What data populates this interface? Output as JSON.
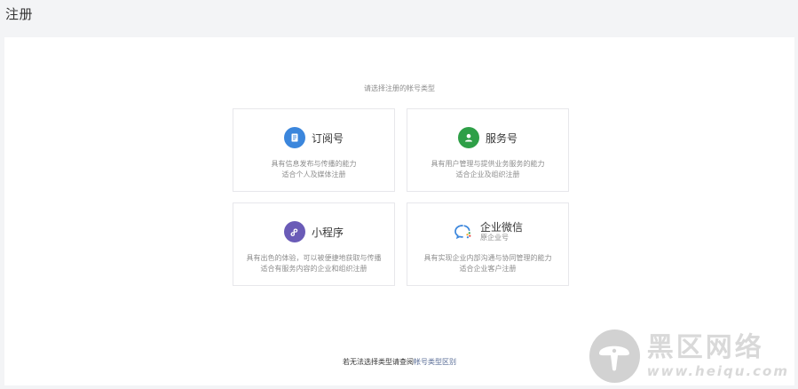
{
  "page": {
    "title": "注册",
    "subtitle": "请选择注册的帐号类型"
  },
  "cards": [
    {
      "id": "subscription",
      "title": "订阅号",
      "subtitle": "",
      "desc_line1": "具有信息发布与传播的能力",
      "desc_line2": "适合个人及媒体注册",
      "icon": "document-icon",
      "icon_color": "#3b86dc"
    },
    {
      "id": "service",
      "title": "服务号",
      "subtitle": "",
      "desc_line1": "具有用户管理与提供业务服务的能力",
      "desc_line2": "适合企业及组织注册",
      "icon": "user-icon",
      "icon_color": "#2e9f47"
    },
    {
      "id": "miniprogram",
      "title": "小程序",
      "subtitle": "",
      "desc_line1": "具有出色的体验，可以被便捷地获取与传播",
      "desc_line2": "适合有服务内容的企业和组织注册",
      "icon": "miniprogram-icon",
      "icon_color": "#6a5bb7"
    },
    {
      "id": "work-wechat",
      "title": "企业微信",
      "subtitle": "原企业号",
      "desc_line1": "具有实现企业内部沟通与协同管理的能力",
      "desc_line2": "适合企业客户注册",
      "icon": "work-wechat-icon",
      "icon_color": "#3b86dc"
    }
  ],
  "footer": {
    "prefix": "若无法选择类型请查阅",
    "link_text": "帐号类型区别"
  },
  "watermark": {
    "text_cn": "黑区网络",
    "text_url": "www.heiqu.com"
  },
  "colors": {
    "background": "#f3f4f6",
    "panel": "#ffffff",
    "card_border": "#e7e7eb",
    "link": "#576b95"
  }
}
